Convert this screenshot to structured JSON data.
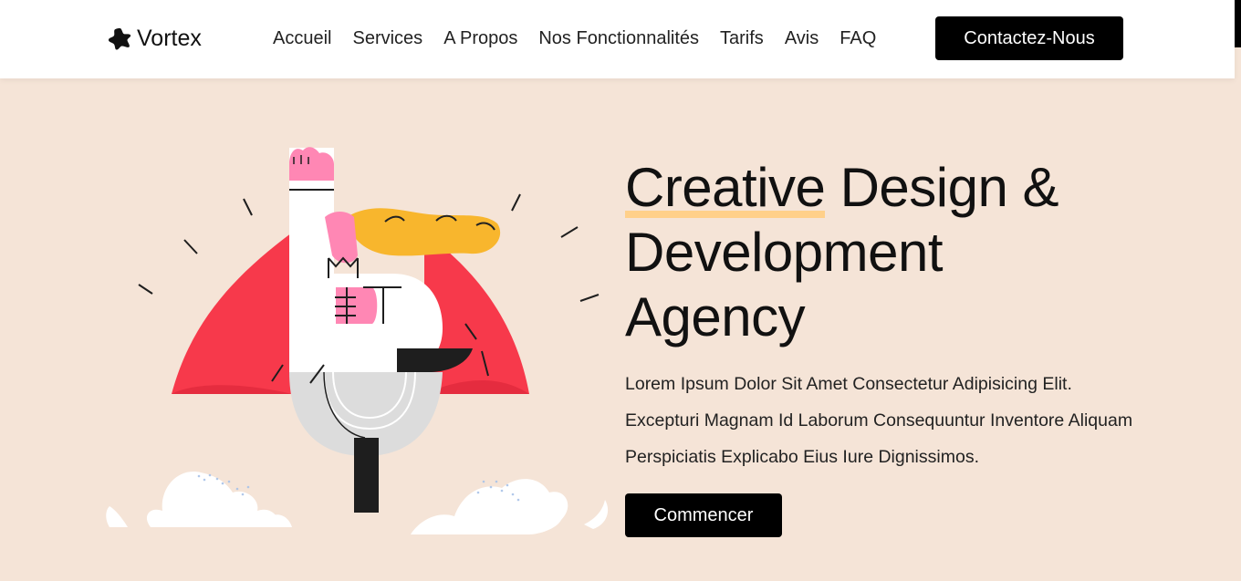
{
  "brand": {
    "name": "Vortex",
    "icon": "star-blob-icon"
  },
  "nav": {
    "links": [
      "Accueil",
      "Services",
      "A Propos",
      "Nos Fonctionnalités",
      "Tarifs",
      "Avis",
      "FAQ"
    ],
    "contact_label": "Contactez-Nous"
  },
  "hero": {
    "title_highlight": "Creative",
    "title_rest_line1": " Design &",
    "title_line2": "Development",
    "title_line3": "Agency",
    "description": "Lorem Ipsum Dolor Sit Amet Consectetur Adipisicing Elit. Excepturi Magnam Id Laborum Consequuntur Inventore Aliquam Perspiciatis Explicabo Eius Iure Dignissimos.",
    "cta_label": "Commencer",
    "illustration": "superhero-letter-illustration"
  },
  "colors": {
    "background": "#f5e4d7",
    "accent_highlight": "#ffd08a",
    "button": "#000000",
    "cape": "#f7394b",
    "hair": "#f8b62d",
    "skin": "#ff87b4"
  }
}
